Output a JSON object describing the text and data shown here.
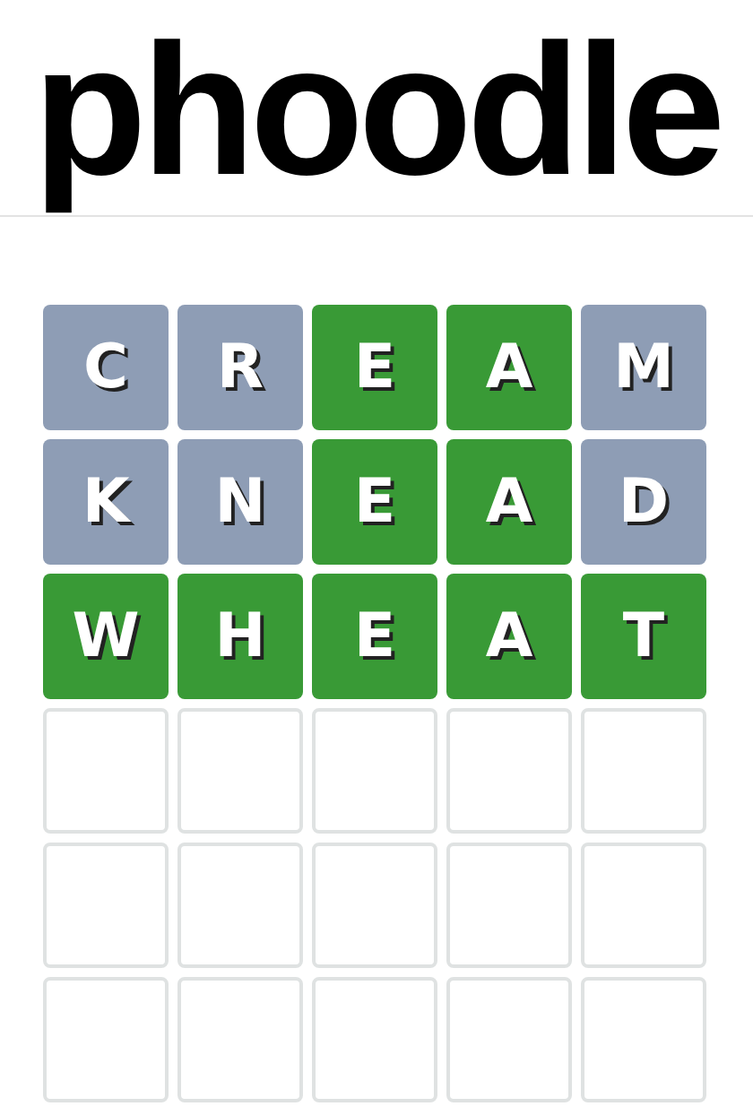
{
  "logo": {
    "text": "phoodle"
  },
  "board": [
    [
      {
        "letter": "C",
        "kind": "absent"
      },
      {
        "letter": "R",
        "kind": "absent"
      },
      {
        "letter": "E",
        "kind": "correct"
      },
      {
        "letter": "A",
        "kind": "correct"
      },
      {
        "letter": "M",
        "kind": "absent"
      }
    ],
    [
      {
        "letter": "K",
        "kind": "absent"
      },
      {
        "letter": "N",
        "kind": "absent"
      },
      {
        "letter": "E",
        "kind": "correct"
      },
      {
        "letter": "A",
        "kind": "correct"
      },
      {
        "letter": "D",
        "kind": "absent"
      }
    ],
    [
      {
        "letter": "W",
        "kind": "correct"
      },
      {
        "letter": "H",
        "kind": "correct"
      },
      {
        "letter": "E",
        "kind": "correct"
      },
      {
        "letter": "A",
        "kind": "correct"
      },
      {
        "letter": "T",
        "kind": "correct"
      }
    ],
    [
      {
        "kind": "empty"
      },
      {
        "kind": "empty"
      },
      {
        "kind": "empty"
      },
      {
        "kind": "empty"
      },
      {
        "kind": "empty"
      }
    ],
    [
      {
        "kind": "empty"
      },
      {
        "kind": "empty"
      },
      {
        "kind": "empty"
      },
      {
        "kind": "empty"
      },
      {
        "kind": "empty"
      }
    ],
    [
      {
        "kind": "empty"
      },
      {
        "kind": "empty"
      },
      {
        "kind": "empty"
      },
      {
        "kind": "empty"
      },
      {
        "kind": "empty"
      }
    ]
  ]
}
